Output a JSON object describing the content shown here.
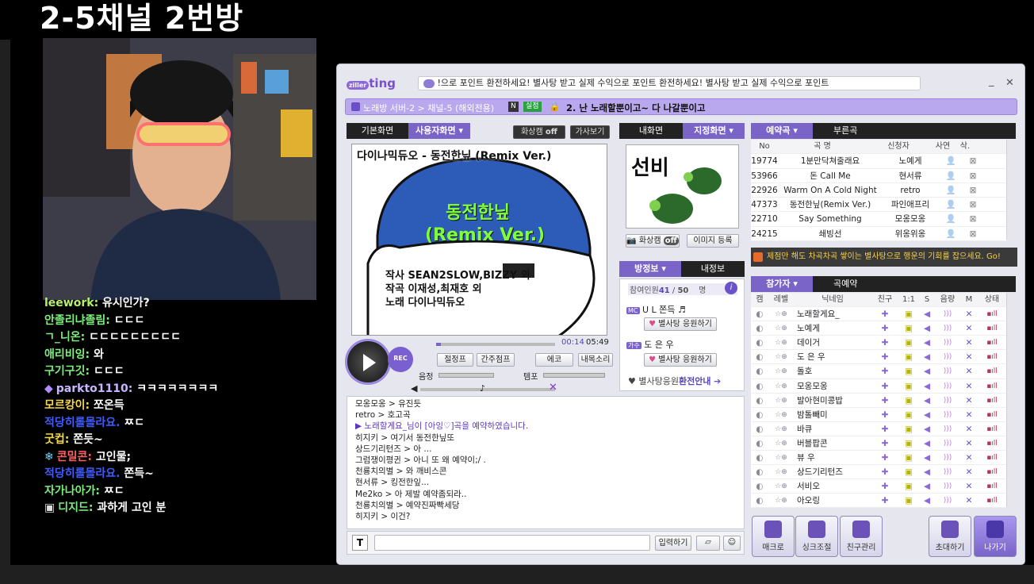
{
  "stream": {
    "title": "2-5채널 2번방",
    "chat": [
      {
        "user": "leework",
        "sep": ": ",
        "msg": "유시인가?",
        "color": "#b6f26c"
      },
      {
        "user": "안졸리냐졸림",
        "sep": ": ",
        "msg": "ㄷㄷㄷ",
        "color": "#7df07c"
      },
      {
        "user": "ㄱ_니온",
        "sep": ": ",
        "msg": "ㄷㄷㄷㄷㄷㄷㄷㄷㄷ",
        "color": "#7df07c"
      },
      {
        "user": "애리비잉",
        "sep": ": ",
        "msg": "와",
        "color": "#7df07c"
      },
      {
        "user": "구기구깃",
        "sep": ": ",
        "msg": "ㄷㄷㄷ",
        "color": "#7df07c"
      },
      {
        "user": "parkto1110",
        "sep": ": ",
        "msg": "ㅋㅋㅋㅋㅋㅋㅋㅋ",
        "color": "#c9b6ff",
        "badge": "diamond"
      },
      {
        "user": "모르캉이",
        "sep": ": ",
        "msg": "쪼온득",
        "color": "#f5d84a"
      },
      {
        "user": "적당히롤몰라요",
        "sep": ". ",
        "msg": "ㅉㄷ",
        "color": "#3f5cff"
      },
      {
        "user": "굿컵",
        "sep": ": ",
        "msg": "쫀듯~",
        "color": "#f5d84a"
      },
      {
        "user": "콘밀콘",
        "sep": ": ",
        "msg": "고인물;",
        "color": "#ff6060",
        "badge": "snow"
      },
      {
        "user": "적당히롤몰라요",
        "sep": ". ",
        "msg": "쫀득~",
        "color": "#3f5cff"
      },
      {
        "user": "자가나아가",
        "sep": ": ",
        "msg": "ㅉㄷ",
        "color": "#7df07c"
      },
      {
        "user": "디지드",
        "sep": ": ",
        "msg": "과하게 고인 분",
        "color": "#7df07c",
        "badge": "book"
      }
    ]
  },
  "app": {
    "logo": "ting",
    "logo_prefix": "ziller",
    "ticker": "!으로 포인트 환전하세요!        별사탕 받고 실제 수익으로 포인트 환전하세요!        별사탕 받고 실제 수익으로 포인트",
    "crumbs": "노래방 서버-2 > 채널-5 (해외전용)",
    "n_badge": "N",
    "live_badge": "실점",
    "room_title": "2. 난 노래할뿐이고~ 다 나갈뿐이고",
    "video": {
      "tab_basic": "기본화면",
      "tab_user": "사용자화면",
      "cam_toggle": "화상캠",
      "cam_state": "off",
      "lyrics_btn": "가사보기",
      "karaoke_header": "다이나믹듀오 - 동전한닢 (Remix Ver.)",
      "song_line1": "동전한닢",
      "song_line2": "(Remix Ver.)",
      "credit1": "작사 SEAN2SLOW,BIZZY 외",
      "credit2": "작곡 이재성,최재호 외",
      "credit3": "노래 다이나믹듀오",
      "time_cur": "00:14",
      "time_total": "05:49",
      "rec": "REC",
      "btn_jump": "절정프",
      "btn_interlude": "간주점프",
      "btn_echo": "에코",
      "btn_backing": "내목소리",
      "vol_label": "음정",
      "tempo_label": "템포"
    },
    "cam_panel": {
      "tab_mine": "내화면",
      "tab_set": "지정화면",
      "caption": "선비",
      "cam_label": "화상캠",
      "cam_state": "off",
      "img_btn": "이미지 등록"
    },
    "room_info": {
      "tab_info": "방정보",
      "tab_my": "내정보",
      "count_label": "참여인원",
      "count_cur": "41",
      "count_max": "50",
      "count_unit": "명",
      "mc_badge": "MC",
      "mc_name": "U L 쫀득 ♬",
      "support_btn": "별사탕 응원하기",
      "singer_badge": "가수",
      "singer_name": "도 은 우",
      "support_btn2": "별사탕 응원하기",
      "exchange_1": "별사탕응원",
      "exchange_2": "환전안내"
    },
    "queue": {
      "tab_reserve": "예약곡",
      "tab_called": "부른곡",
      "headers": [
        "No",
        "곡 명",
        "신청자",
        "사연",
        "삭."
      ],
      "rows": [
        {
          "no": "19774",
          "title": "1분만닥쳐줄래요",
          "who": "노예게"
        },
        {
          "no": "53966",
          "title": "돈 Call Me",
          "who": "현서류"
        },
        {
          "no": "22926",
          "title": "Warm On A Cold Night",
          "who": "retro"
        },
        {
          "no": "47373",
          "title": "동전한닢(Remix Ver.)",
          "who": "파인애프리"
        },
        {
          "no": "22710",
          "title": "Say Something",
          "who": "모옹모옹"
        },
        {
          "no": "24215",
          "title": "쇄빙선",
          "who": "위옹위옹"
        }
      ]
    },
    "banner": "제점만 해도 차곡차곡 쌓이는 별사탕으로 행운의 기회를 잡으세요. Go!",
    "participants": {
      "tab_users": "참가자",
      "tab_song": "곡예약",
      "headers": [
        "캠",
        "레벨",
        "닉네임",
        "친구",
        "1:1",
        "S",
        "음량",
        "M",
        "상태"
      ],
      "rows": [
        "노래할게요_",
        "노예게",
        "데이거",
        "도 은 우",
        "돌호",
        "모옹모옹",
        "발아현미콩밥",
        "밤톨빼미",
        "바큐",
        "버블팝콘",
        "뷰 우",
        "상드기리턴즈",
        "서비오",
        "아오링"
      ]
    },
    "chatlog": [
      "모옹모옹 > 유진듯",
      "retro > 호고곡",
      "▶ 노래할게요_님이 [아잉♡]곡을 예약하였습니다.",
      "히지키 > 여기서 동전한닢또",
      "상드기리턴즈 > 아 ...",
      "그럼쟁이평귄 > 아니 또 왜 예약이;/ .",
      "천룡치의별 > 와 깨비스콘",
      "현서류 > 킹전한잎...",
      "Me2ko > 아 제발 예약좀되라..",
      "천룡치의별 > 예약진짜빡세당",
      "히지키 > 이건?"
    ],
    "input": {
      "placeholder": "",
      "send": "입력하기"
    },
    "bottom_btns": {
      "macro": "매크로",
      "sync": "싱크조절",
      "friends": "친구관리",
      "invite": "초대하기",
      "leave": "나가기"
    }
  }
}
